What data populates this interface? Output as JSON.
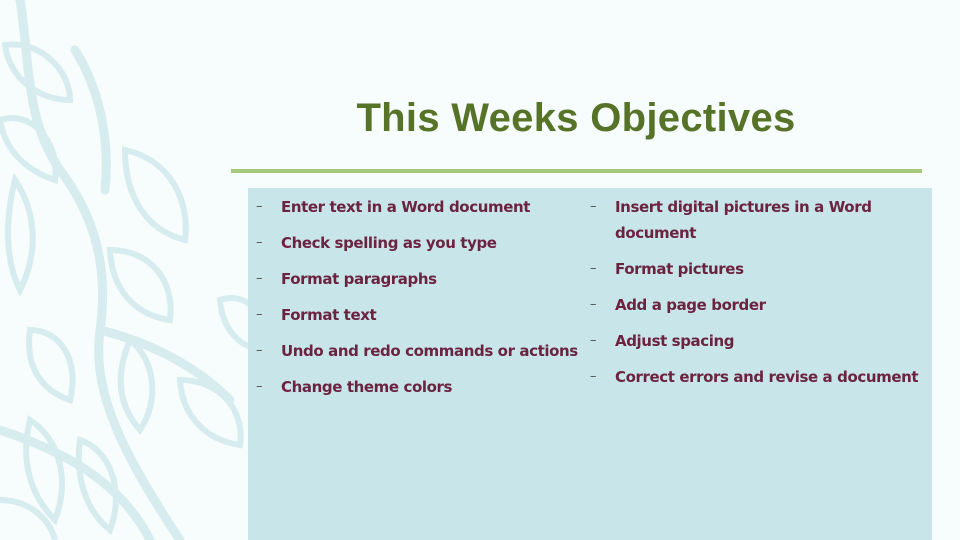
{
  "slide": {
    "title": "This Weeks Objectives",
    "bullet_glyph": "–",
    "left_column": [
      "Enter text in a Word document",
      "Check spelling as you type",
      "Format paragraphs",
      "Format text",
      "Undo and redo commands or actions",
      "Change theme colors"
    ],
    "right_column": [
      "Insert digital pictures in a Word document",
      "Format pictures",
      "Add a page border",
      "Adjust spacing",
      "Correct errors and revise a document"
    ]
  },
  "colors": {
    "title": "#577328",
    "rule": "#a6c87a",
    "panel": "#c8e6ea",
    "bullet_text": "#6b2340",
    "background": "#f7fcfc",
    "decor": "#d9eef0"
  }
}
